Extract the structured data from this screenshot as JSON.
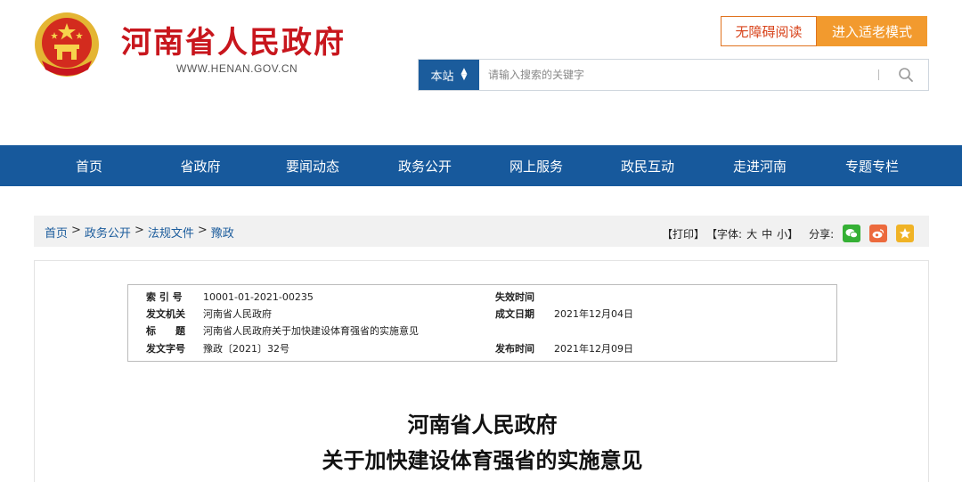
{
  "header": {
    "site_title": "河南省人民政府",
    "site_url": "WWW.HENAN.GOV.CN",
    "accessibility_label": "无障碍阅读",
    "elder_mode_label": "进入适老模式"
  },
  "search": {
    "scope_label": "本站",
    "placeholder": "请输入搜索的关键字",
    "icon": "search-icon"
  },
  "nav": {
    "items": [
      "首页",
      "省政府",
      "要闻动态",
      "政务公开",
      "网上服务",
      "政民互动",
      "走进河南",
      "专题专栏"
    ]
  },
  "breadcrumb": {
    "items": [
      "首页",
      "政务公开",
      "法规文件",
      "豫政"
    ],
    "separator": ">"
  },
  "tools": {
    "print": "【打印】",
    "font_label": "【字体:",
    "font_large": "大",
    "font_medium": "中",
    "font_small": "小】",
    "share_label": "分享:",
    "share_icons": [
      "wechat-icon",
      "weibo-icon",
      "star-icon"
    ]
  },
  "meta": {
    "index_label": "索 引 号",
    "index_value": "10001-01-2021-00235",
    "issuer_label": "发文机关",
    "issuer_value": "河南省人民政府",
    "title_label": "标　　题",
    "title_value": "河南省人民政府关于加快建设体育强省的实施意见",
    "docno_label": "发文字号",
    "docno_value": "豫政〔2021〕32号",
    "expire_label": "失效时间",
    "expire_value": "",
    "created_label": "成文日期",
    "created_value": "2021年12月04日",
    "published_label": "发布时间",
    "published_value": "2021年12月09日"
  },
  "document": {
    "title_line1": "河南省人民政府",
    "title_line2": "关于加快建设体育强省的实施意见"
  },
  "colors": {
    "brand_red": "#c8161d",
    "nav_blue": "#17599c",
    "elder_orange": "#f29a2e"
  }
}
